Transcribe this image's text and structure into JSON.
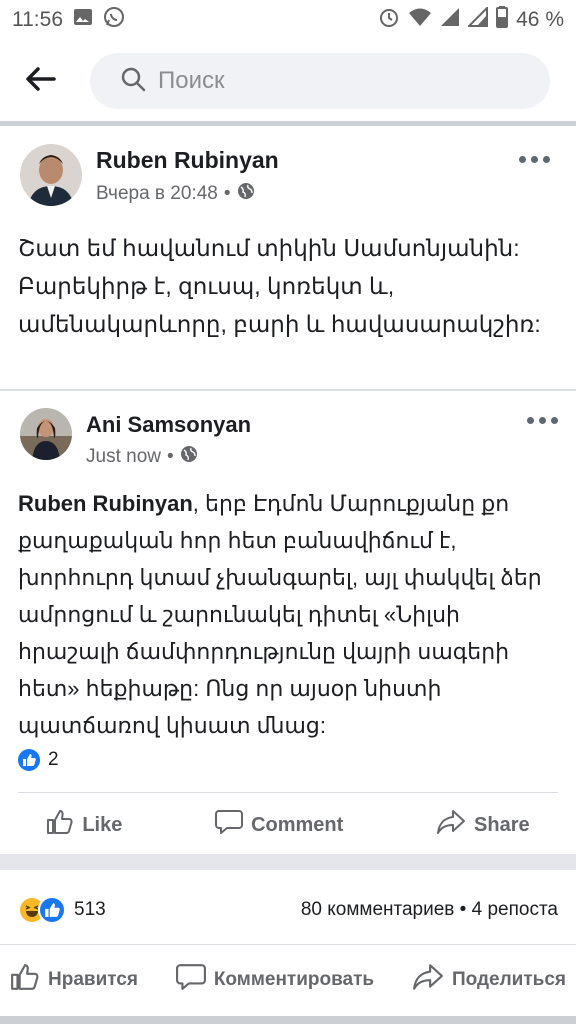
{
  "status_bar": {
    "time": "11:56",
    "battery": "46 %",
    "icons": [
      "gallery-icon",
      "whatsapp-icon",
      "alarm-icon",
      "wifi-icon",
      "signal-icon",
      "signal-icon",
      "battery-icon"
    ]
  },
  "search": {
    "placeholder": "Поиск"
  },
  "post": {
    "author": "Ruben Rubinyan",
    "time": "Вчера в 20:48",
    "audience_icon": "globe-icon",
    "text": "Շատ եմ հավանում տիկին Սամսոնյանին: Բարեկիրթ է, զուսպ, կոռեկտ և, ամենակարևորը, բարի և հավասարակշիռ:"
  },
  "shared": {
    "author": "Ani  Samsonyan",
    "time": "Just now",
    "audience_icon": "globe-icon",
    "mention": "Ruben Rubinyan",
    "text": ", երբ Էդմոն Մարուքյանը քո քաղաքական հոր հետ բանավիճում է, խորհուրդ կտամ չխանգարել, այլ փակվել ձեր ամրոցում և շարունակել դիտել «Նիլսի հրաշալի ճամփորդությունը վայրի սագերի հետ» հեքիաթը: Ոնց որ այսօր նիստի պատճառով կիսատ մնաց:",
    "like_count": "2",
    "actions": {
      "like": "Like",
      "comment": "Comment",
      "share": "Share"
    }
  },
  "footer_stats": {
    "reaction_count": "513",
    "comments_shares": "80 комментариев • 4 репоста"
  },
  "footer_actions": {
    "like": "Нравится",
    "comment": "Комментировать",
    "share": "Поделиться"
  },
  "colors": {
    "accent": "#1877f2",
    "secondary_text": "#65676b",
    "separator": "#ccd0d5"
  }
}
